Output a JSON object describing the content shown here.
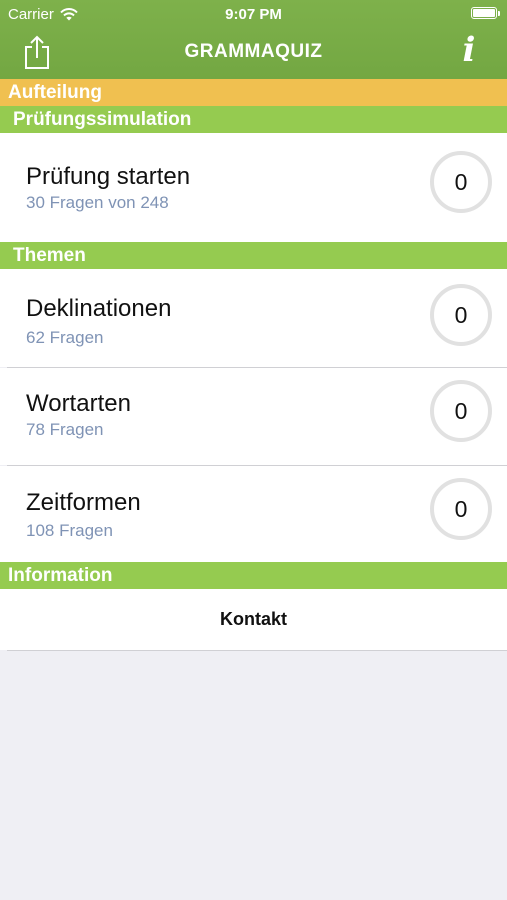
{
  "status_bar": {
    "carrier": "Carrier",
    "time": "9:07 PM"
  },
  "nav": {
    "title": "GRAMMAQUIZ",
    "share_icon": "share-icon",
    "info_icon": "info-icon",
    "info_glyph": "i"
  },
  "sections": {
    "aufteilung": "Aufteilung",
    "pruefung": "Prüfungssimulation",
    "themen": "Themen",
    "information": "Information"
  },
  "exam": {
    "title": "Prüfung starten",
    "subtitle": "30 Fragen von 248",
    "score": "0"
  },
  "topics": [
    {
      "title": "Deklinationen",
      "subtitle": "62 Fragen",
      "score": "0"
    },
    {
      "title": "Wortarten",
      "subtitle": "78 Fragen",
      "score": "0"
    },
    {
      "title": "Zeitformen",
      "subtitle": "108 Fragen",
      "score": "0"
    }
  ],
  "info": {
    "contact_label": "Kontakt"
  },
  "colors": {
    "nav_green": "#7eb14b",
    "section_green": "#95cb50",
    "section_orange": "#f0c050",
    "subtitle_blue": "#7f93b5"
  }
}
